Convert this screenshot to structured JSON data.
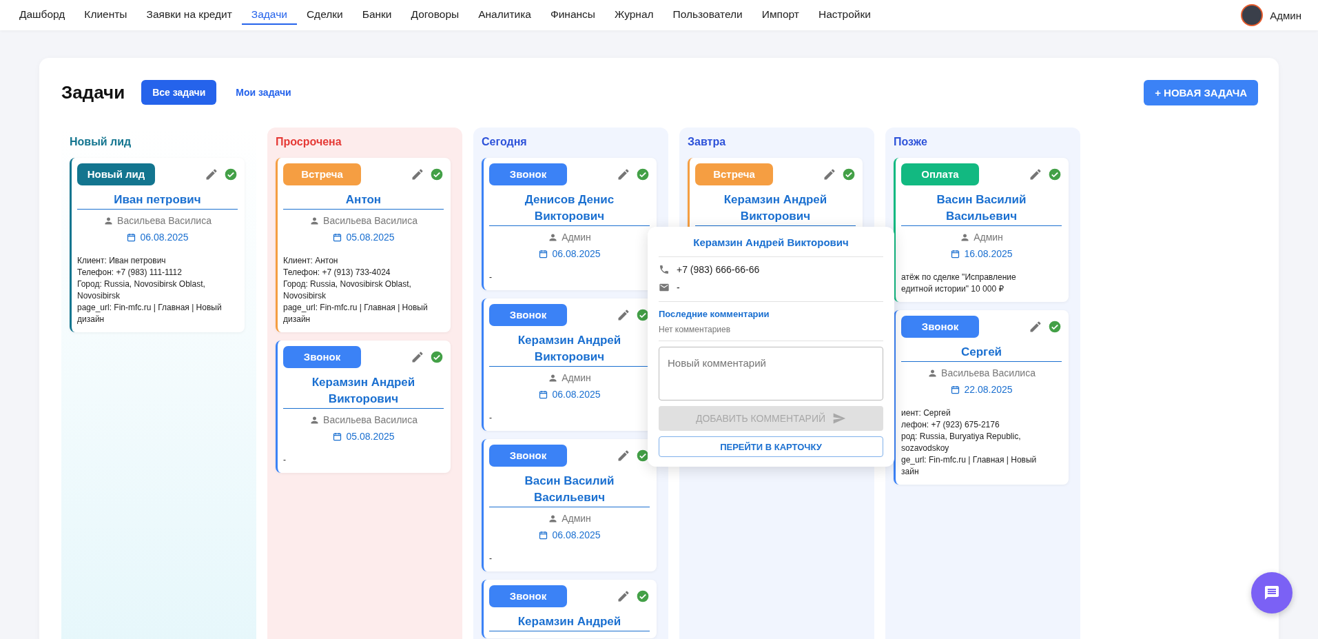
{
  "nav": {
    "items": [
      {
        "label": "Дашборд",
        "selected": false
      },
      {
        "label": "Клиенты",
        "selected": false
      },
      {
        "label": "Заявки на кредит",
        "selected": false
      },
      {
        "label": "Задачи",
        "selected": true
      },
      {
        "label": "Сделки",
        "selected": false
      },
      {
        "label": "Банки",
        "selected": false
      },
      {
        "label": "Договоры",
        "selected": false
      },
      {
        "label": "Аналитика",
        "selected": false
      },
      {
        "label": "Финансы",
        "selected": false
      },
      {
        "label": "Журнал",
        "selected": false
      },
      {
        "label": "Пользователи",
        "selected": false
      },
      {
        "label": "Импорт",
        "selected": false
      },
      {
        "label": "Настройки",
        "selected": false
      }
    ],
    "user": "Админ"
  },
  "header": {
    "title": "Задачи",
    "filters": [
      {
        "label": "Все задачи",
        "selected": true
      },
      {
        "label": "Мои задачи",
        "selected": false
      }
    ],
    "new_task_button": "+ НОВАЯ ЗАДАЧА"
  },
  "columns": [
    {
      "kind": "new_lead",
      "title": "Новый лид",
      "cards": [
        {
          "kind": "new_lead",
          "badge": "Новый лид",
          "name": "Иван петрович",
          "assignee": "Васильева Василиса",
          "date": "06.08.2025",
          "description": "Клиент: Иван петрович\nТелефон: +7 (983) 111-1112\nГород: Russia, Novosibirsk Oblast, Novosibirsk\npage_url: Fin-mfc.ru | Главная | Новый дизайн"
        }
      ]
    },
    {
      "kind": "overdue",
      "title": "Просрочена",
      "cards": [
        {
          "kind": "meeting",
          "badge": "Встреча",
          "name": "Антон",
          "assignee": "Васильева Василиса",
          "date": "05.08.2025",
          "description": "Клиент: Антон\nТелефон: +7 (913) 733-4024\nГород: Russia, Novosibirsk Oblast, Novosibirsk\npage_url: Fin-mfc.ru | Главная | Новый дизайн"
        },
        {
          "kind": "call",
          "badge": "Звонок",
          "name": "Керамзин Андрей Викторович",
          "assignee": "Васильева Василиса",
          "date": "05.08.2025",
          "description": "-"
        }
      ]
    },
    {
      "kind": "today",
      "title": "Сегодня",
      "cards": [
        {
          "kind": "call",
          "badge": "Звонок",
          "name": "Денисов Денис Викторович",
          "assignee": "Админ",
          "date": "06.08.2025",
          "description": "-"
        },
        {
          "kind": "call",
          "badge": "Звонок",
          "name": "Керамзин Андрей Викторович",
          "assignee": "Админ",
          "date": "06.08.2025",
          "description": "-"
        },
        {
          "kind": "call",
          "badge": "Звонок",
          "name": "Васин Василий Васильевич",
          "assignee": "Админ",
          "date": "06.08.2025",
          "description": "-"
        },
        {
          "kind": "call",
          "badge": "Звонок",
          "name": "Керамзин Андрей"
        }
      ]
    },
    {
      "kind": "tomorrow",
      "title": "Завтра",
      "cards": [
        {
          "kind": "meeting",
          "badge": "Встреча",
          "name": "Керамзин Андрей Викторович"
        }
      ]
    },
    {
      "kind": "later",
      "title": "Позже",
      "cards": [
        {
          "kind": "payment",
          "badge": "Оплата",
          "name": "Васин Василий Васильевич",
          "assignee": "Админ",
          "date": "16.08.2025",
          "description": "атёж по сделке \"Исправление\nедитной истории\" 10 000 ₽"
        },
        {
          "kind": "call",
          "badge": "Звонок",
          "name": "Сергей",
          "assignee": "Васильева Василиса",
          "date": "22.08.2025",
          "description": "иент: Сергей\nлефон: +7 (923) 675-2176\nрод: Russia, Buryatiya Republic,\nsozavodskoy\nge_url: Fin-mfc.ru | Главная | Новый\nзайн"
        }
      ]
    }
  ],
  "popover": {
    "name": "Керамзин Андрей Викторович",
    "phone": "+7 (983) 666-66-66",
    "email": "-",
    "comments_title": "Последние комментарии",
    "no_comments": "Нет комментариев",
    "comment_placeholder": "Новый комментарий",
    "add_button": {
      "label": "ДОБАВИТЬ КОММЕНТАРИЙ",
      "disabled": true
    },
    "open_card_button": "ПЕРЕЙТИ В КАРТОЧКУ"
  }
}
